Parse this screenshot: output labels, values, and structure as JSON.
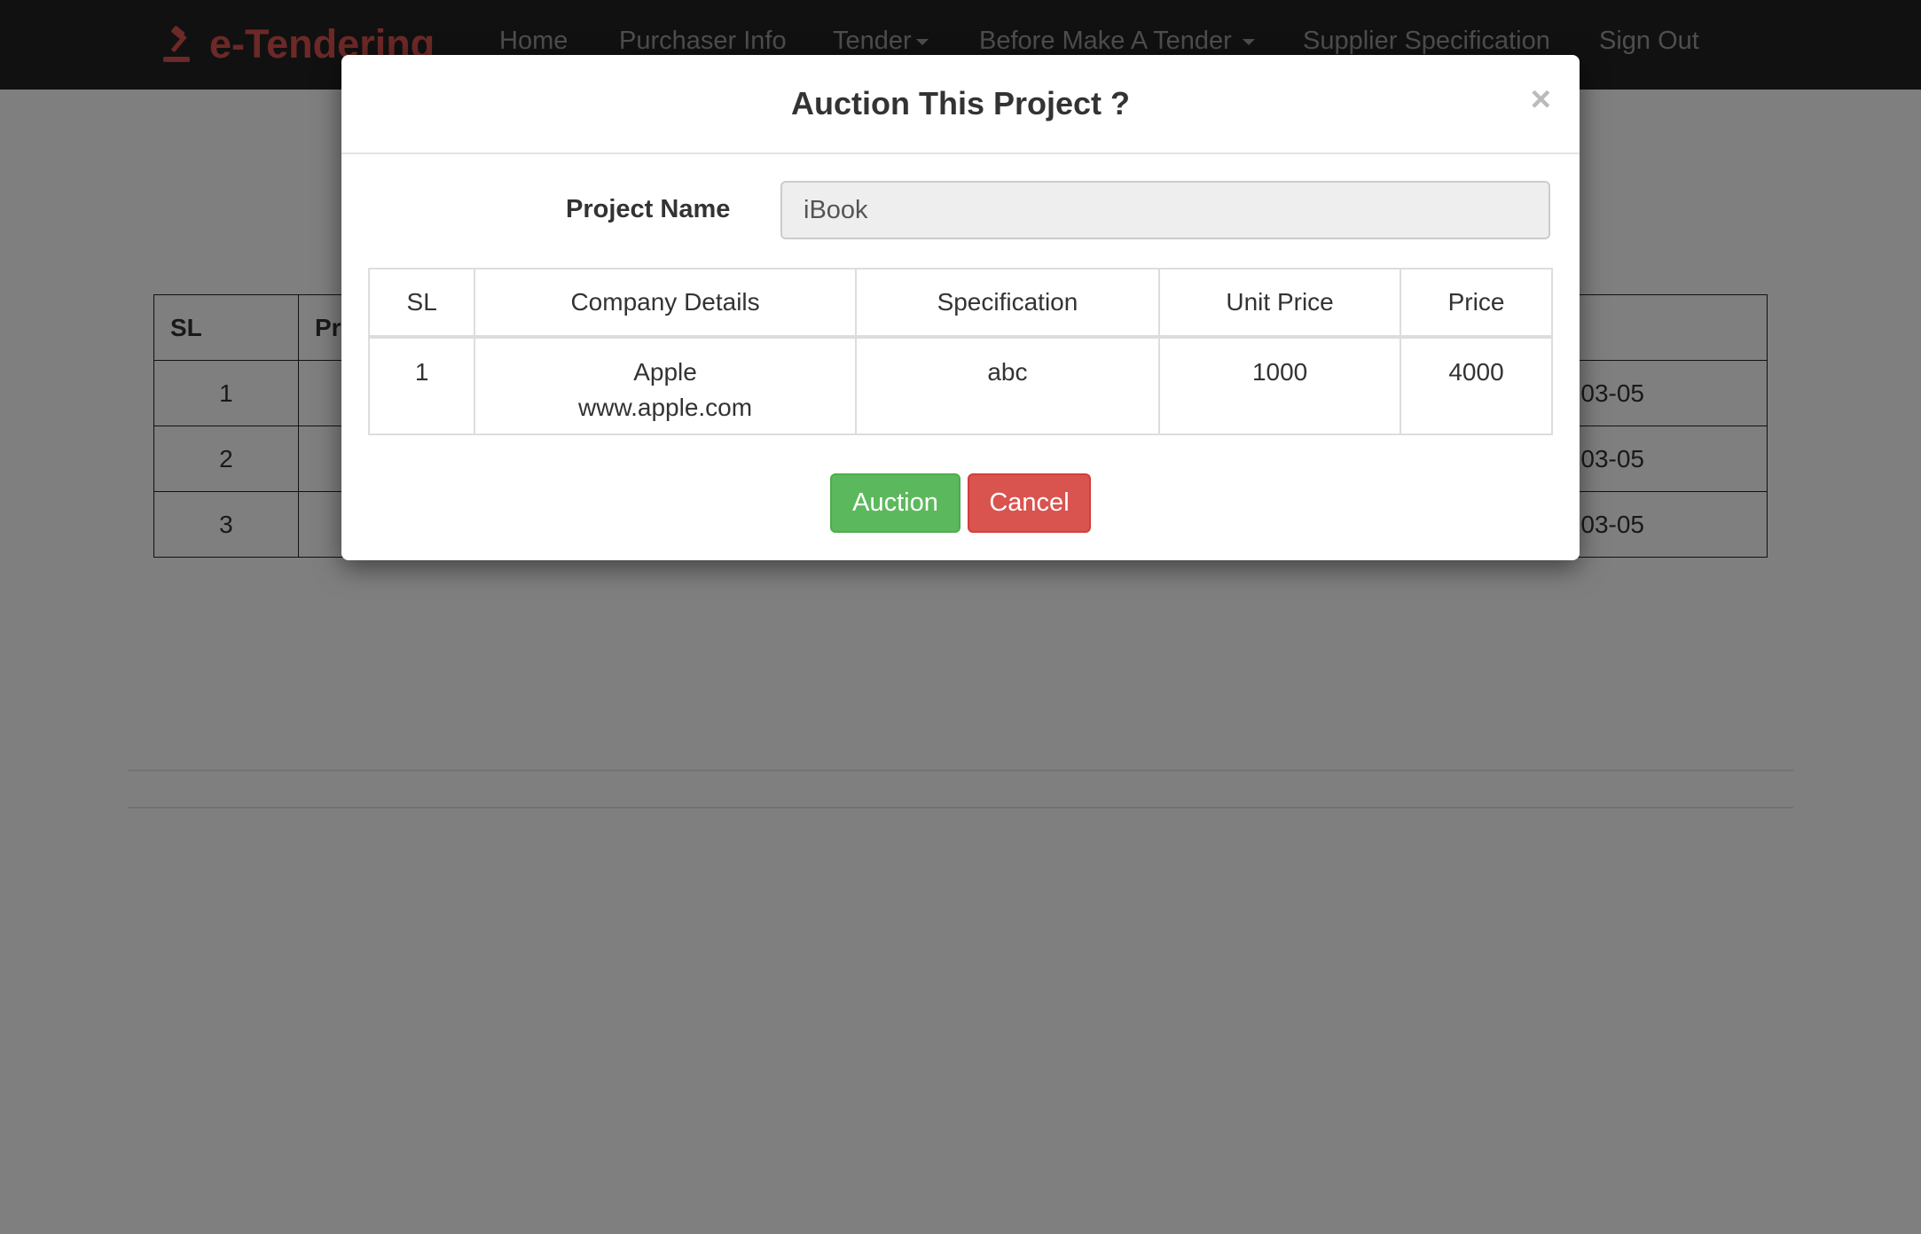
{
  "navbar": {
    "brand": "e-Tendering",
    "items": [
      {
        "label": "Home",
        "dropdown": false
      },
      {
        "label": "Purchaser Info",
        "dropdown": false
      },
      {
        "label": "Tender",
        "dropdown": true
      },
      {
        "label": "Before Make A Tender",
        "dropdown": true
      },
      {
        "label": "Supplier Specification",
        "dropdown": false
      },
      {
        "label": "Sign Out",
        "dropdown": false
      }
    ]
  },
  "background_table": {
    "headers": [
      "SL",
      "Pr"
    ],
    "rows": [
      {
        "sl": "1",
        "date": "03-05"
      },
      {
        "sl": "2",
        "date": "03-05"
      },
      {
        "sl": "3",
        "date": "03-05"
      }
    ]
  },
  "modal": {
    "title": "Auction This Project ?",
    "close": "×",
    "project_name_label": "Project Name",
    "project_name_value": "iBook",
    "table": {
      "headers": [
        "SL",
        "Company Details",
        "Specification",
        "Unit Price",
        "Price"
      ],
      "rows": [
        {
          "sl": "1",
          "company": "Apple",
          "website": "www.apple.com",
          "specification": "abc",
          "unit_price": "1000",
          "price": "4000"
        }
      ]
    },
    "auction_label": "Auction",
    "cancel_label": "Cancel"
  },
  "colors": {
    "brand": "#d9534f",
    "navbar_bg": "#222222",
    "success": "#5cb85c",
    "danger": "#d9534f"
  }
}
